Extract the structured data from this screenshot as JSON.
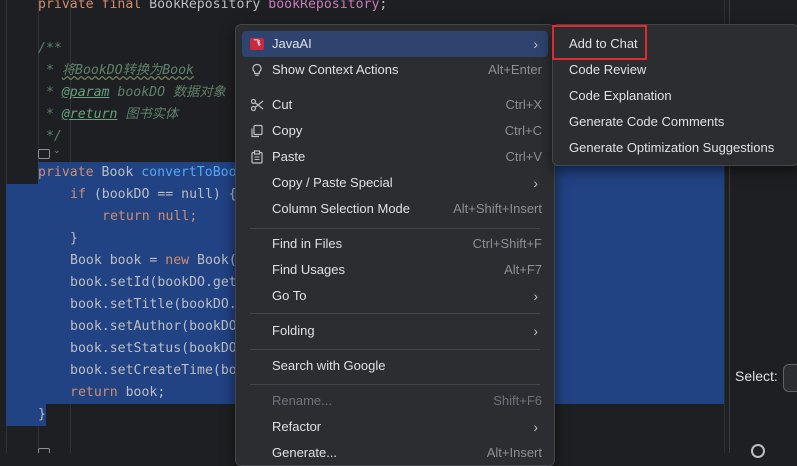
{
  "code": {
    "line0": {
      "kw": "private final ",
      "type": "BookRepository ",
      "field": "bookRepository",
      "end": ";"
    },
    "doc_open": "/**",
    "doc_line1": {
      "star": " * ",
      "text": "将BookDO转换为Book"
    },
    "doc_line2": {
      "star": " * ",
      "tag": "@param",
      "name": " bookDO ",
      "desc": "数据对象"
    },
    "doc_line3": {
      "star": " * ",
      "tag": "@return",
      "desc": " 图书实体"
    },
    "doc_close": " */",
    "sig": {
      "kw": "private ",
      "type": "Book ",
      "fn": "convertToBoo"
    },
    "l_if": {
      "kw": "if ",
      "rest": "(bookDO == null) {"
    },
    "l_ret": {
      "kw": "return ",
      "rest": "null;"
    },
    "l_close1": "}",
    "l_new": {
      "pre": "Book book = ",
      "kw": "new ",
      "rest": "Book("
    },
    "l_setid": "book.setId(bookDO.get",
    "l_settitle": "book.setTitle(bookDO.",
    "l_setauthor": "book.setAuthor(bookDO",
    "l_setstatus": "book.setStatus(bookDO",
    "l_setct": "book.setCreateTime(bo",
    "l_retbook": {
      "kw": "return ",
      "rest": "book;"
    },
    "l_close2": "}"
  },
  "context_menu": {
    "items": [
      {
        "label": "JavaAI",
        "shortcut": "",
        "submenu": true,
        "icon": "javaai-icon"
      },
      {
        "label": "Show Context Actions",
        "shortcut": "Alt+Enter",
        "icon": "lightbulb-icon"
      },
      {
        "label": "Cut",
        "shortcut": "Ctrl+X",
        "icon": "scissors-icon"
      },
      {
        "label": "Copy",
        "shortcut": "Ctrl+C",
        "icon": "copy-icon"
      },
      {
        "label": "Paste",
        "shortcut": "Ctrl+V",
        "icon": "paste-icon"
      },
      {
        "label": "Copy / Paste Special",
        "shortcut": "",
        "submenu": true
      },
      {
        "label": "Column Selection Mode",
        "shortcut": "Alt+Shift+Insert"
      },
      {
        "label": "Find in Files",
        "shortcut": "Ctrl+Shift+F"
      },
      {
        "label": "Find Usages",
        "shortcut": "Alt+F7"
      },
      {
        "label": "Go To",
        "shortcut": "",
        "submenu": true
      },
      {
        "label": "Folding",
        "shortcut": "",
        "submenu": true
      },
      {
        "label": "Search with Google",
        "shortcut": ""
      },
      {
        "label": "Rename...",
        "shortcut": "Shift+F6",
        "disabled": true
      },
      {
        "label": "Refactor",
        "shortcut": "",
        "submenu": true
      },
      {
        "label": "Generate...",
        "shortcut": "Alt+Insert"
      }
    ]
  },
  "submenu": {
    "items": [
      {
        "label": "Add to Chat"
      },
      {
        "label": "Code Review"
      },
      {
        "label": "Code Explanation"
      },
      {
        "label": "Generate Code Comments"
      },
      {
        "label": "Generate Optimization Suggestions"
      }
    ]
  },
  "right_panel": {
    "select_label": "Select:"
  },
  "colors": {
    "selection": "#214283",
    "menu_bg": "#2b2d30",
    "highlight_box": "#e0282e",
    "active_item": "#2e436e"
  }
}
